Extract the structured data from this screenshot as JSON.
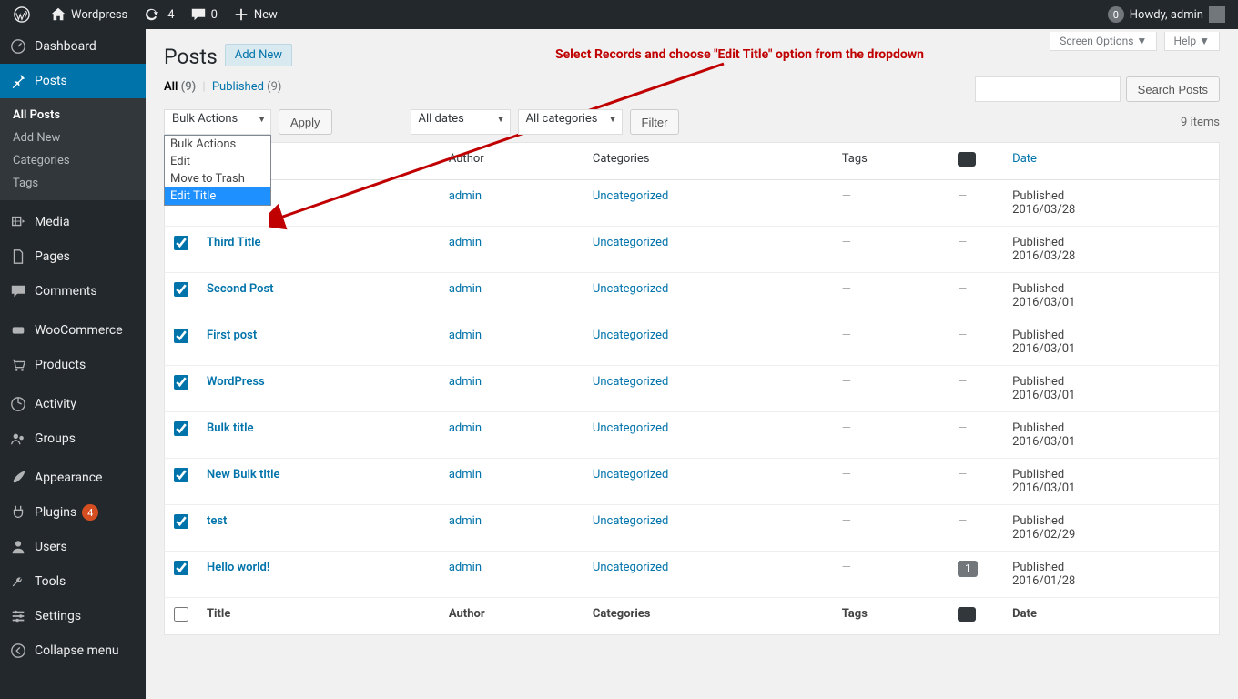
{
  "toolbar": {
    "site_name": "Wordpress",
    "updates_count": "4",
    "comments_count": "0",
    "new_label": "New",
    "howdy_prefix": "Howdy,",
    "user_name": "admin",
    "notification_badge": "0"
  },
  "sidebar": {
    "items": [
      {
        "label": "Dashboard",
        "icon": "dashboard"
      },
      {
        "label": "Posts",
        "icon": "pin",
        "current": true,
        "submenu": [
          {
            "label": "All Posts",
            "current": true
          },
          {
            "label": "Add New"
          },
          {
            "label": "Categories"
          },
          {
            "label": "Tags"
          }
        ]
      },
      {
        "label": "Media",
        "icon": "media"
      },
      {
        "label": "Pages",
        "icon": "page"
      },
      {
        "label": "Comments",
        "icon": "comment"
      },
      {
        "label": "WooCommerce",
        "icon": "woo"
      },
      {
        "label": "Products",
        "icon": "cart"
      },
      {
        "label": "Activity",
        "icon": "activity"
      },
      {
        "label": "Groups",
        "icon": "groups"
      },
      {
        "label": "Appearance",
        "icon": "brush"
      },
      {
        "label": "Plugins",
        "icon": "plug",
        "badge": "4"
      },
      {
        "label": "Users",
        "icon": "user"
      },
      {
        "label": "Tools",
        "icon": "wrench"
      },
      {
        "label": "Settings",
        "icon": "settings"
      },
      {
        "label": "Collapse menu",
        "icon": "collapse"
      }
    ]
  },
  "page": {
    "title": "Posts",
    "add_new": "Add New",
    "screen_options": "Screen Options",
    "help": "Help",
    "annotation": "Select Records and choose \"Edit Title\" option from the dropdown"
  },
  "filters": {
    "views": {
      "all_label": "All",
      "all_count": "(9)",
      "published_label": "Published",
      "published_count": "(9)"
    },
    "bulk_selected": "Bulk Actions",
    "bulk_options": [
      "Bulk Actions",
      "Edit",
      "Move to Trash",
      "Edit Title"
    ],
    "bulk_highlighted": "Edit Title",
    "apply": "Apply",
    "dates": "All dates",
    "categories": "All categories",
    "filter": "Filter",
    "search_button": "Search Posts",
    "items_count": "9 items"
  },
  "table": {
    "columns": {
      "title": "Title",
      "author": "Author",
      "categories": "Categories",
      "tags": "Tags",
      "date": "Date"
    },
    "published_label": "Published",
    "rows": [
      {
        "title": "",
        "author": "admin",
        "category": "Uncategorized",
        "tags": "—",
        "comments": "—",
        "date": "2016/03/28",
        "checked": false
      },
      {
        "title": "Third Title",
        "author": "admin",
        "category": "Uncategorized",
        "tags": "—",
        "comments": "—",
        "date": "2016/03/28",
        "checked": true
      },
      {
        "title": "Second Post",
        "author": "admin",
        "category": "Uncategorized",
        "tags": "—",
        "comments": "—",
        "date": "2016/03/01",
        "checked": true
      },
      {
        "title": "First post",
        "author": "admin",
        "category": "Uncategorized",
        "tags": "—",
        "comments": "—",
        "date": "2016/03/01",
        "checked": true
      },
      {
        "title": "WordPress",
        "author": "admin",
        "category": "Uncategorized",
        "tags": "—",
        "comments": "—",
        "date": "2016/03/01",
        "checked": true
      },
      {
        "title": "Bulk title",
        "author": "admin",
        "category": "Uncategorized",
        "tags": "—",
        "comments": "—",
        "date": "2016/03/01",
        "checked": true
      },
      {
        "title": "New Bulk title",
        "author": "admin",
        "category": "Uncategorized",
        "tags": "—",
        "comments": "—",
        "date": "2016/03/01",
        "checked": true
      },
      {
        "title": "test",
        "author": "admin",
        "category": "Uncategorized",
        "tags": "—",
        "comments": "—",
        "date": "2016/02/29",
        "checked": true
      },
      {
        "title": "Hello world!",
        "author": "admin",
        "category": "Uncategorized",
        "tags": "—",
        "comments": "1",
        "date": "2016/01/28",
        "checked": true
      }
    ]
  }
}
